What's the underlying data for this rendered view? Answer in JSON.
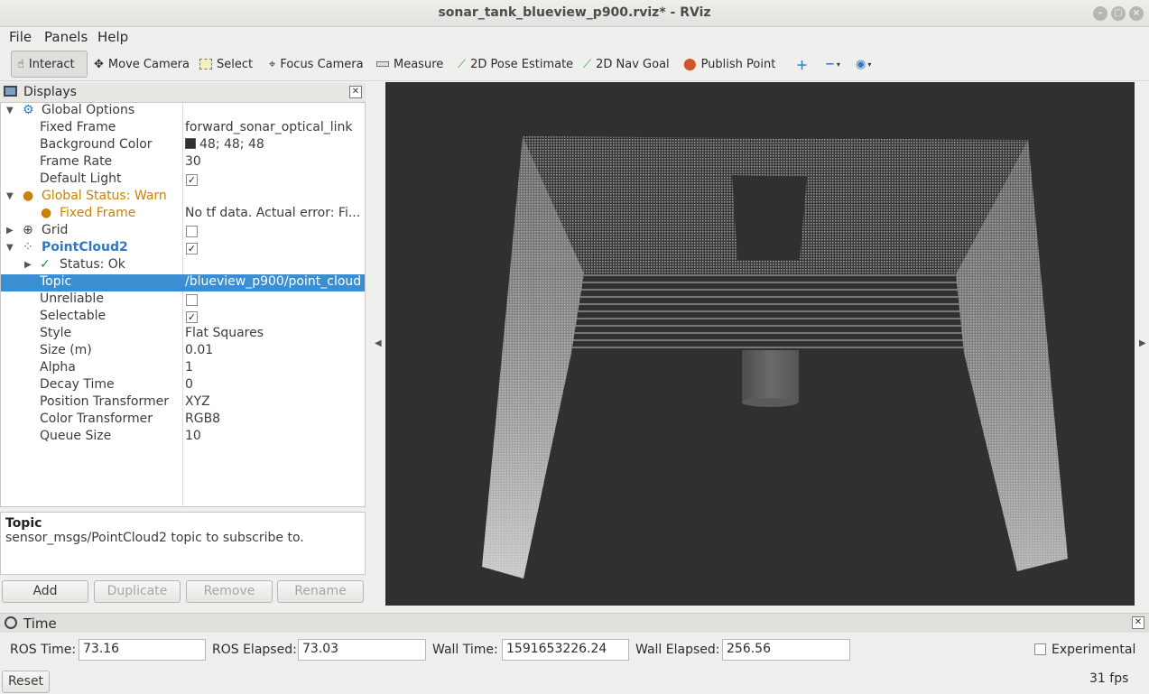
{
  "window": {
    "title": "sonar_tank_blueview_p900.rviz* - RViz"
  },
  "menu": [
    "File",
    "Panels",
    "Help"
  ],
  "toolbar": {
    "interact": "Interact",
    "move_camera": "Move Camera",
    "select": "Select",
    "focus_camera": "Focus Camera",
    "measure": "Measure",
    "pose_estimate": "2D Pose Estimate",
    "nav_goal": "2D Nav Goal",
    "publish_point": "Publish Point"
  },
  "displays": {
    "title": "Displays",
    "rows": [
      {
        "key": "Global Options",
        "value": ""
      },
      {
        "key": "Fixed Frame",
        "value": "forward_sonar_optical_link"
      },
      {
        "key": "Background Color",
        "value": "48; 48; 48"
      },
      {
        "key": "Frame Rate",
        "value": "30"
      },
      {
        "key": "Default Light",
        "value": ""
      },
      {
        "key": "Global Status: Warn",
        "value": ""
      },
      {
        "key": "Fixed Frame",
        "value": "No tf data.  Actual error: Fi..."
      },
      {
        "key": "Grid",
        "value": ""
      },
      {
        "key": "PointCloud2",
        "value": ""
      },
      {
        "key": "Status: Ok",
        "value": ""
      },
      {
        "key": "Topic",
        "value": "/blueview_p900/point_cloud"
      },
      {
        "key": "Unreliable",
        "value": ""
      },
      {
        "key": "Selectable",
        "value": ""
      },
      {
        "key": "Style",
        "value": "Flat Squares"
      },
      {
        "key": "Size (m)",
        "value": "0.01"
      },
      {
        "key": "Alpha",
        "value": "1"
      },
      {
        "key": "Decay Time",
        "value": "0"
      },
      {
        "key": "Position Transformer",
        "value": "XYZ"
      },
      {
        "key": "Color Transformer",
        "value": "RGB8"
      },
      {
        "key": "Queue Size",
        "value": "10"
      }
    ],
    "background_color": "#303030"
  },
  "description": {
    "title": "Topic",
    "text": "sensor_msgs/PointCloud2 topic to subscribe to."
  },
  "buttons": {
    "add": "Add",
    "duplicate": "Duplicate",
    "remove": "Remove",
    "rename": "Rename"
  },
  "time": {
    "title": "Time",
    "ros_time_label": "ROS Time:",
    "ros_time": "73.16",
    "ros_elapsed_label": "ROS Elapsed:",
    "ros_elapsed": "73.03",
    "wall_time_label": "Wall Time:",
    "wall_time": "1591653226.24",
    "wall_elapsed_label": "Wall Elapsed:",
    "wall_elapsed": "256.56",
    "experimental_label": "Experimental",
    "reset_label": "Reset",
    "fps": "31 fps"
  },
  "colors": {
    "selection": "#3a8ed1",
    "warn": "#c98209",
    "viewport_bg": "#303030"
  }
}
